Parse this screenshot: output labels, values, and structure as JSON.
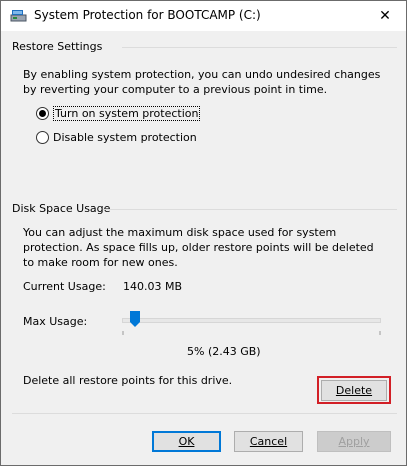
{
  "window": {
    "title": "System Protection for BOOTCAMP (C:)",
    "close_glyph": "✕"
  },
  "restore_settings": {
    "group_label": "Restore Settings",
    "description": "By enabling system protection, you can undo undesired changes by reverting your computer to a previous point in time.",
    "options": [
      {
        "label": "Turn on system protection",
        "checked": true
      },
      {
        "label": "Disable system protection",
        "checked": false
      }
    ]
  },
  "disk_space": {
    "group_label": "Disk Space Usage",
    "description": "You can adjust the maximum disk space used for system protection. As space fills up, older restore points will be deleted to make room for new ones.",
    "current_usage_label": "Current Usage:",
    "current_usage_value": "140.03 MB",
    "max_usage_label": "Max Usage:",
    "max_usage_value": "5% (2.43 GB)",
    "max_usage_fraction": 0.05,
    "delete_text": "Delete all restore points for this drive.",
    "delete_button": "Delete"
  },
  "footer": {
    "ok_label": "OK",
    "cancel_label": "Cancel",
    "apply_label": "Apply"
  },
  "colors": {
    "accent": "#0078d7",
    "highlight": "#d21f26",
    "background": "#f0f0f0"
  },
  "icons": {
    "title": "drive-protection-icon",
    "close": "close-icon"
  }
}
